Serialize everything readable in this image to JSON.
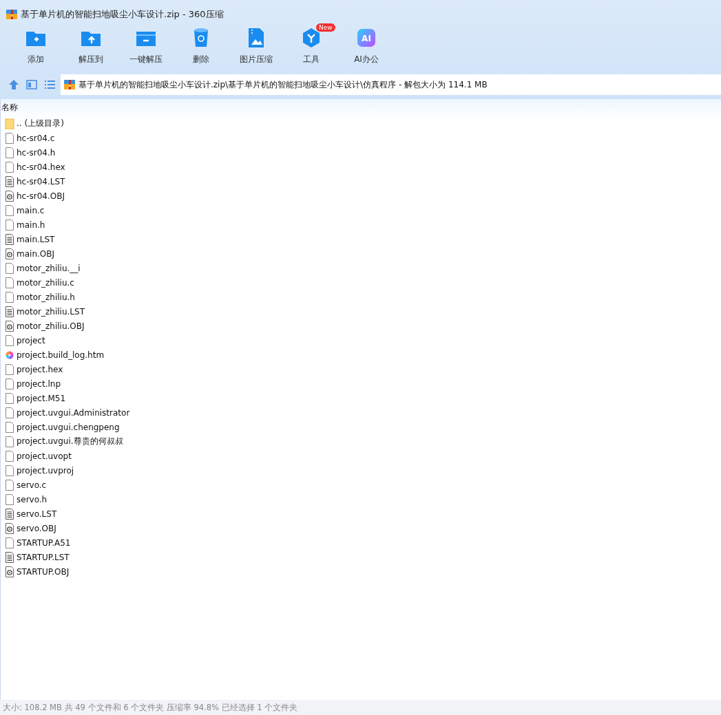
{
  "window": {
    "title": "基于单片机的智能扫地吸尘小车设计.zip - 360压缩"
  },
  "toolbar": [
    {
      "kind": "add",
      "label": "添加"
    },
    {
      "kind": "extract-to",
      "label": "解压到"
    },
    {
      "kind": "one-click",
      "label": "一键解压"
    },
    {
      "kind": "delete",
      "label": "删除"
    },
    {
      "kind": "image",
      "label": "图片压缩"
    },
    {
      "kind": "tools",
      "label": "工具",
      "badge": "New"
    },
    {
      "kind": "ai",
      "label": "AI办公",
      "icon_text": "AI"
    }
  ],
  "address_bar": {
    "path": "基于单片机的智能扫地吸尘小车设计.zip\\基于单片机的智能扫地吸尘小车设计\\仿真程序 - 解包大小为 114.1 MB"
  },
  "file_list": {
    "columns": [
      "名称"
    ],
    "rows": [
      {
        "name": ".. (上级目录)",
        "kind": "folder"
      },
      {
        "name": "hc-sr04.c",
        "kind": "blank"
      },
      {
        "name": "hc-sr04.h",
        "kind": "blank"
      },
      {
        "name": "hc-sr04.hex",
        "kind": "blank"
      },
      {
        "name": "hc-sr04.LST",
        "kind": "text"
      },
      {
        "name": "hc-sr04.OBJ",
        "kind": "obj"
      },
      {
        "name": "main.c",
        "kind": "blank"
      },
      {
        "name": "main.h",
        "kind": "blank"
      },
      {
        "name": "main.LST",
        "kind": "text"
      },
      {
        "name": "main.OBJ",
        "kind": "obj"
      },
      {
        "name": "motor_zhiliu.__i",
        "kind": "blank"
      },
      {
        "name": "motor_zhiliu.c",
        "kind": "blank"
      },
      {
        "name": "motor_zhiliu.h",
        "kind": "blank"
      },
      {
        "name": "motor_zhiliu.LST",
        "kind": "text"
      },
      {
        "name": "motor_zhiliu.OBJ",
        "kind": "obj"
      },
      {
        "name": "project",
        "kind": "blank"
      },
      {
        "name": "project.build_log.htm",
        "kind": "web"
      },
      {
        "name": "project.hex",
        "kind": "blank"
      },
      {
        "name": "project.lnp",
        "kind": "blank"
      },
      {
        "name": "project.M51",
        "kind": "blank"
      },
      {
        "name": "project.uvgui.Administrator",
        "kind": "blank"
      },
      {
        "name": "project.uvgui.chengpeng",
        "kind": "blank"
      },
      {
        "name": "project.uvgui.尊贵的何叔叔",
        "kind": "blank"
      },
      {
        "name": "project.uvopt",
        "kind": "blank"
      },
      {
        "name": "project.uvproj",
        "kind": "blank"
      },
      {
        "name": "servo.c",
        "kind": "blank"
      },
      {
        "name": "servo.h",
        "kind": "blank"
      },
      {
        "name": "servo.LST",
        "kind": "text"
      },
      {
        "name": "servo.OBJ",
        "kind": "obj"
      },
      {
        "name": "STARTUP.A51",
        "kind": "blank"
      },
      {
        "name": "STARTUP.LST",
        "kind": "text"
      },
      {
        "name": "STARTUP.OBJ",
        "kind": "obj"
      }
    ]
  },
  "status_bar": {
    "text": "大小: 108.2 MB 共 49 个文件和 6 个文件夹 压缩率 94.8% 已经选择 1 个文件夹"
  }
}
